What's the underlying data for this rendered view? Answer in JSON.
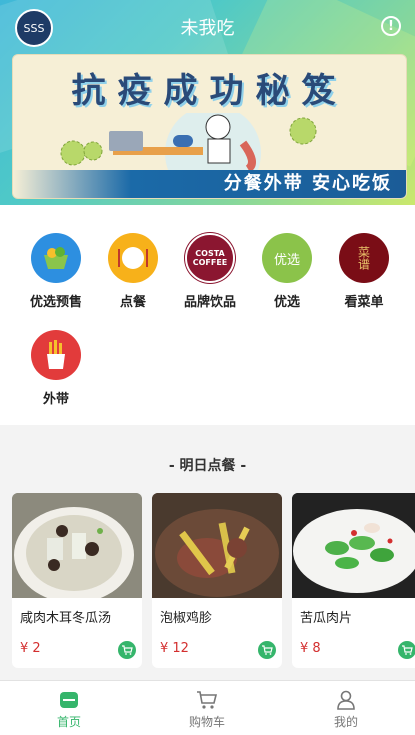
{
  "header": {
    "app_title": "未我吃",
    "logo_text": "SSS"
  },
  "banner": {
    "title": "抗疫成功秘笈",
    "slogan": "分餐外带 安心吃饭"
  },
  "categories": [
    {
      "label": "优选预售",
      "icon": "fruit-basket-icon",
      "color": "#2d8fe0"
    },
    {
      "label": "点餐",
      "icon": "plate-utensils-icon",
      "color": "#f7b11a"
    },
    {
      "label": "品牌饮品",
      "icon": "costa-coffee-logo",
      "color": "#8b1630",
      "logo_text": "COSTA COFFEE"
    },
    {
      "label": "优选",
      "icon": "youxuan-bag-icon",
      "color": "#8bc34a",
      "logo_text": "优选"
    },
    {
      "label": "看菜单",
      "icon": "menu-book-icon",
      "color": "#7a0d16",
      "logo_text": "菜谱"
    },
    {
      "label": "外带",
      "icon": "fries-icon",
      "color": "#e23b3b"
    }
  ],
  "section": {
    "title": "- 明日点餐 -"
  },
  "dishes": [
    {
      "name": "咸肉木耳冬瓜汤",
      "price": "¥ 2"
    },
    {
      "name": "泡椒鸡胗",
      "price": "¥ 12"
    },
    {
      "name": "苦瓜肉片",
      "price": "¥ 8"
    }
  ],
  "tabbar": {
    "home": "首页",
    "cart": "购物车",
    "mine": "我的"
  },
  "colors": {
    "accent": "#35b56b",
    "price": "#d32f2f"
  }
}
